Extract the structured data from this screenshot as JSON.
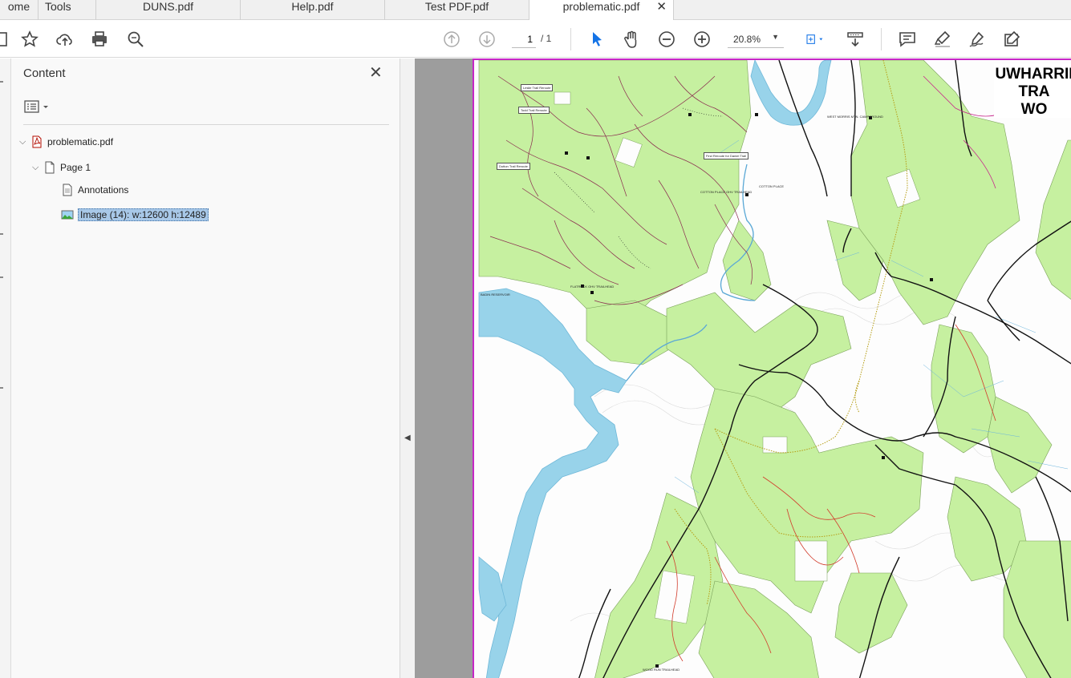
{
  "tabs": [
    {
      "label": "ome"
    },
    {
      "label": "Tools"
    },
    {
      "label": "DUNS.pdf"
    },
    {
      "label": "Help.pdf"
    },
    {
      "label": "Test PDF.pdf"
    },
    {
      "label": "problematic.pdf",
      "active": true
    }
  ],
  "toolbar": {
    "page_current": "1",
    "page_total": "/ 1",
    "zoom": "20.8%",
    "accent_color": "#1473e6"
  },
  "panel": {
    "title": "Content",
    "tree": [
      {
        "label": "problematic.pdf",
        "level": 0,
        "icon": "pdf-file-icon",
        "expanded": true
      },
      {
        "label": "Page 1",
        "level": 1,
        "icon": "page-icon",
        "expanded": true
      },
      {
        "label": "Annotations",
        "level": 2,
        "icon": "document-icon"
      },
      {
        "label": "Image (14): w:12600 h:12489",
        "level": 2,
        "icon": "image-icon",
        "selected": true
      }
    ]
  },
  "map": {
    "title_lines": [
      "UWHARRII",
      "TRA",
      "WO"
    ],
    "labels": [
      "Leslie Trail Reroute",
      "Todd Trail Reroute",
      "Dutton Trail Reroute",
      "Find Reroute for Daniel Trail",
      "COTTON PLACE",
      "WEST MORRIS MTN. CAMPGROUND",
      "BADIN RESERVOIR",
      "COTTON PLACE OHV TRAILHEAD",
      "FLATROCK OHV TRAILHEAD",
      "WOOD RUN TRAILHEAD"
    ]
  }
}
